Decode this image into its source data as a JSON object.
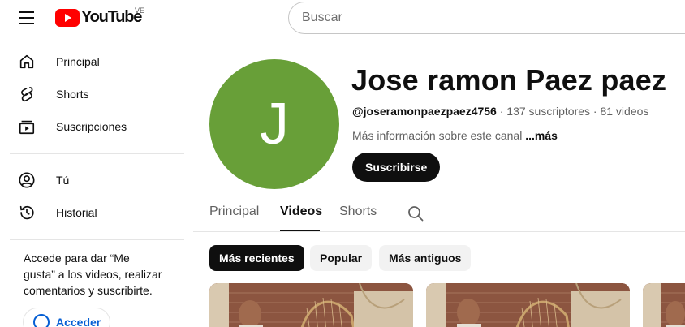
{
  "header": {
    "logo_text": "YouTube",
    "country_code": "VE",
    "search_placeholder": "Buscar"
  },
  "sidebar": {
    "items": [
      {
        "label": "Principal",
        "icon": "home-icon"
      },
      {
        "label": "Shorts",
        "icon": "shorts-icon"
      },
      {
        "label": "Suscripciones",
        "icon": "subscriptions-icon"
      },
      {
        "label": "Tú",
        "icon": "user-icon"
      },
      {
        "label": "Historial",
        "icon": "history-icon"
      }
    ],
    "signin_prompt": "Accede para dar “Me gusta” a los videos, realizar comentarios y suscribirte.",
    "signin_label": "Acceder"
  },
  "channel": {
    "avatar_letter": "J",
    "avatar_color": "#689f38",
    "name": "Jose ramon Paez paez",
    "handle": "@joseramonpaezpaez4756",
    "subscribers": "137 suscriptores",
    "videos": "81 videos",
    "separator": " · ",
    "about": "Más información sobre este canal ",
    "about_more": "...más",
    "subscribe_label": "Suscribirse"
  },
  "tabs": [
    {
      "label": "Principal",
      "active": false
    },
    {
      "label": "Videos",
      "active": true
    },
    {
      "label": "Shorts",
      "active": false
    }
  ],
  "chips": [
    {
      "label": "Más recientes",
      "active": true
    },
    {
      "label": "Popular",
      "active": false
    },
    {
      "label": "Más antiguos",
      "active": false
    }
  ],
  "colors": {
    "brand_red": "#ff0000",
    "link_blue": "#065fd4",
    "text_primary": "#0f0f0f",
    "text_secondary": "#606060"
  }
}
